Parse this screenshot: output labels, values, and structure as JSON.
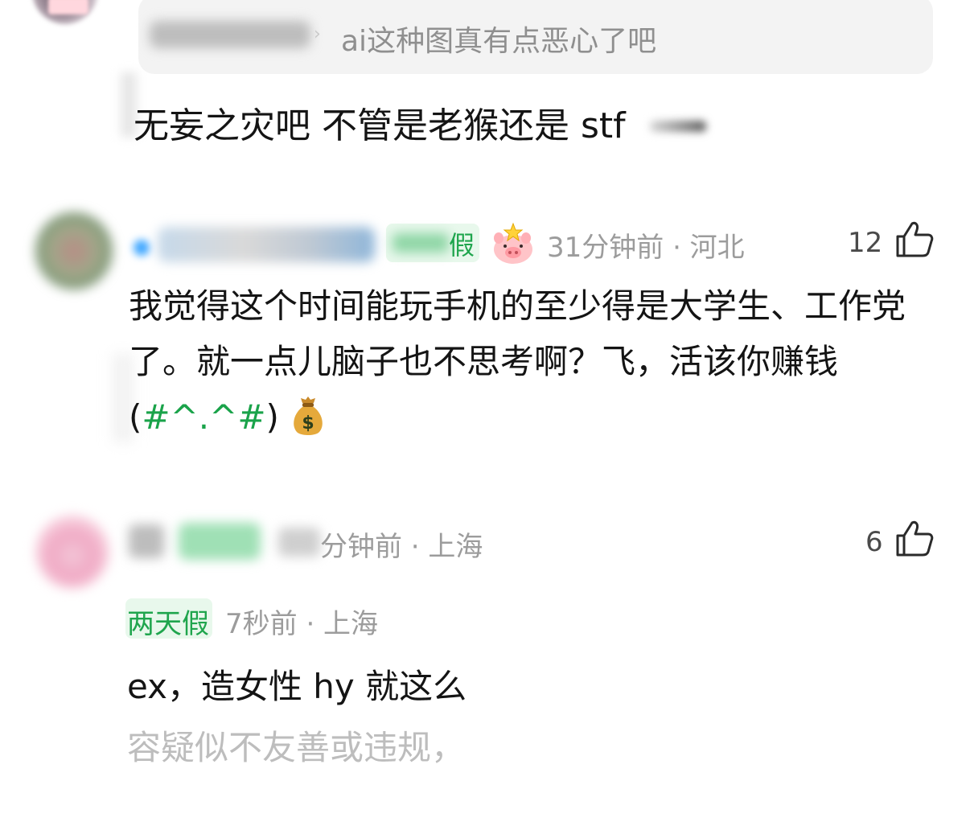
{
  "quote": {
    "text": "ai这种图真有点恶心了吧"
  },
  "top_reply": {
    "text": "无妄之灾吧 不管是老猴还是 stf"
  },
  "comment1": {
    "tag": "假",
    "meta": "31分钟前 · 河北",
    "likes": "12",
    "body_main": "我觉得这个时间能玩手机的至少得是大学生、工作党了。就一点儿脑子也不思考啊？飞，活该你赚钱 (",
    "body_emoticon": "#^.^#",
    "body_end": ")"
  },
  "comment2": {
    "meta": "分钟前 · 上海",
    "likes": "6"
  },
  "comment3": {
    "tag": "两天假",
    "meta": "7秒前 · 上海",
    "body": "ex，造女性 hy 就这么",
    "warning": "容疑似不友善或违规，"
  },
  "icons": {
    "like": "thumbs-up-icon",
    "pig": "pig-avatar-badge-icon",
    "money": "money-bag-icon"
  },
  "colors": {
    "tag_green": "#1fa54d",
    "meta_gray": "#9c9c9c",
    "quote_bg": "#f3f3f3"
  }
}
